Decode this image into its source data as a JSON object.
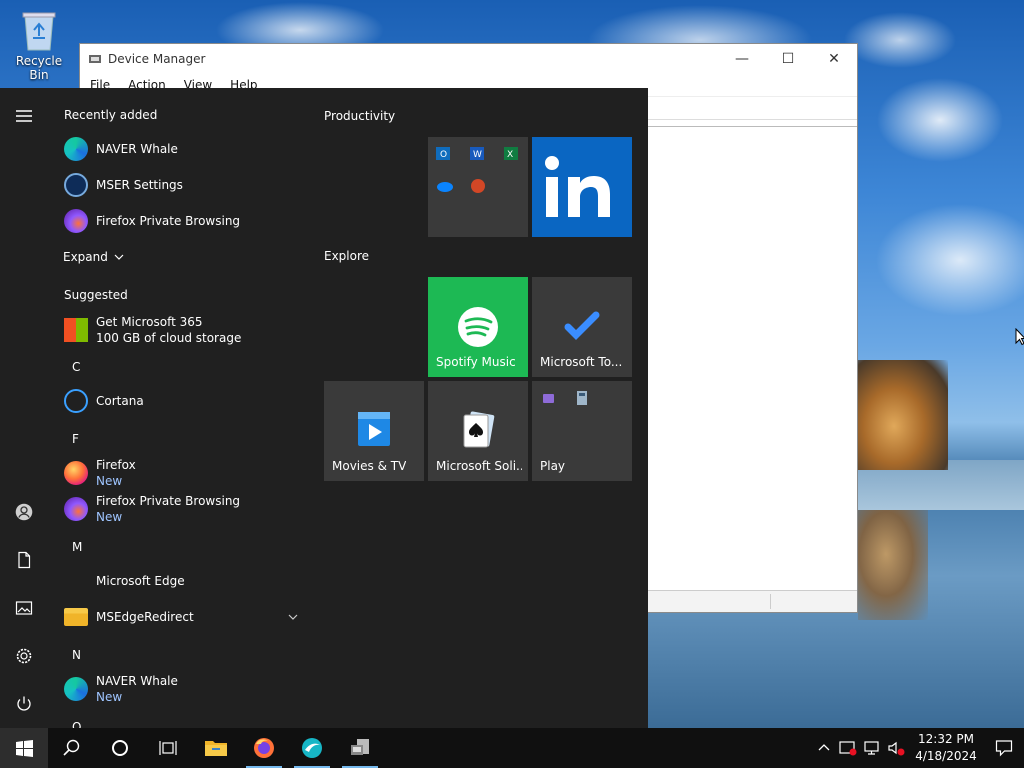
{
  "desktop": {
    "recycle_bin_label": "Recycle Bin"
  },
  "window": {
    "title": "Device Manager",
    "menu": [
      "File",
      "Action",
      "View",
      "Help"
    ],
    "controls": {
      "minimize": "—",
      "maximize": "☐",
      "close": "✕"
    }
  },
  "start_menu": {
    "recently_added_title": "Recently added",
    "recent": [
      {
        "name": "NAVER Whale",
        "icon": "naver-whale-icon"
      },
      {
        "name": "MSER Settings",
        "icon": "mser-settings-icon"
      },
      {
        "name": "Firefox Private Browsing",
        "icon": "firefox-private-icon"
      }
    ],
    "expand_label": "Expand",
    "suggested_title": "Suggested",
    "suggested": {
      "name": "Get Microsoft 365",
      "sub": "100 GB of cloud storage"
    },
    "letters": {
      "c": "C",
      "f": "F",
      "m": "M",
      "n": "N",
      "o": "O"
    },
    "apps": {
      "cortana": "Cortana",
      "firefox": {
        "name": "Firefox",
        "sub": "New"
      },
      "firefox_private": {
        "name": "Firefox Private Browsing",
        "sub": "New"
      },
      "edge": "Microsoft Edge",
      "msedgeredirect": "MSEdgeRedirect",
      "naver": {
        "name": "NAVER Whale",
        "sub": "New"
      }
    },
    "groups": {
      "productivity": "Productivity",
      "explore": "Explore"
    },
    "tiles": {
      "spotify": "Spotify Music",
      "todo": "Microsoft To...",
      "movies": "Movies & TV",
      "solitaire": "Microsoft Soli...",
      "play": "Play"
    }
  },
  "taskbar": {
    "time": "12:32 PM",
    "date": "4/18/2024"
  },
  "colors": {
    "start_bg": "#202020",
    "spotify_green": "#1db954",
    "linkedin_blue": "#0a66c2",
    "accent": "#76b9ed"
  }
}
